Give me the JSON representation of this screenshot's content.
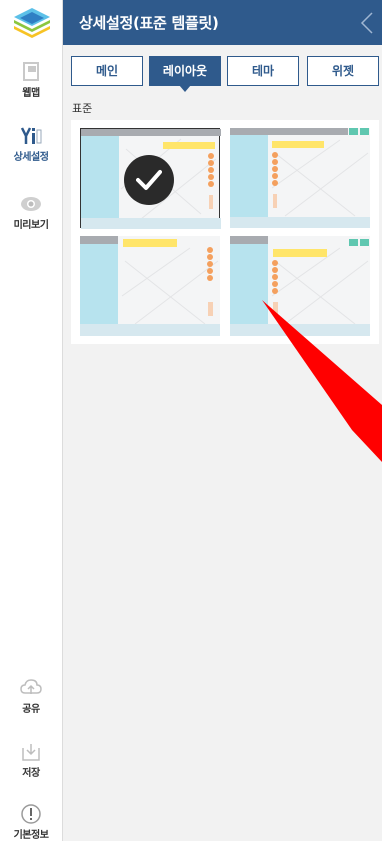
{
  "header": {
    "title": "상세설정(표준 템플릿)"
  },
  "rail": {
    "items": [
      {
        "label": "웹맵",
        "icon": "webmap-icon"
      },
      {
        "label": "상세설정",
        "icon": "detail-settings-icon"
      },
      {
        "label": "미리보기",
        "icon": "preview-eye-icon"
      },
      {
        "label": "공유",
        "icon": "share-cloud-icon"
      },
      {
        "label": "저장",
        "icon": "save-icon"
      },
      {
        "label": "기본정보",
        "icon": "info-icon"
      }
    ]
  },
  "tabs": [
    {
      "label": "메인"
    },
    {
      "label": "레이아웃",
      "active": true
    },
    {
      "label": "테마"
    },
    {
      "label": "위젯"
    }
  ],
  "section": {
    "label": "표준"
  },
  "layouts": {
    "selected_index": 0,
    "count": 4
  },
  "colors": {
    "header": "#2f5a8c",
    "thumb_sidebar": "#b7e3ee",
    "thumb_bar": "#ffe56a",
    "thumb_dots": "#f4a05e",
    "thumb_teal": "#5fc7b0",
    "annotation_arrow": "#ff0000"
  }
}
